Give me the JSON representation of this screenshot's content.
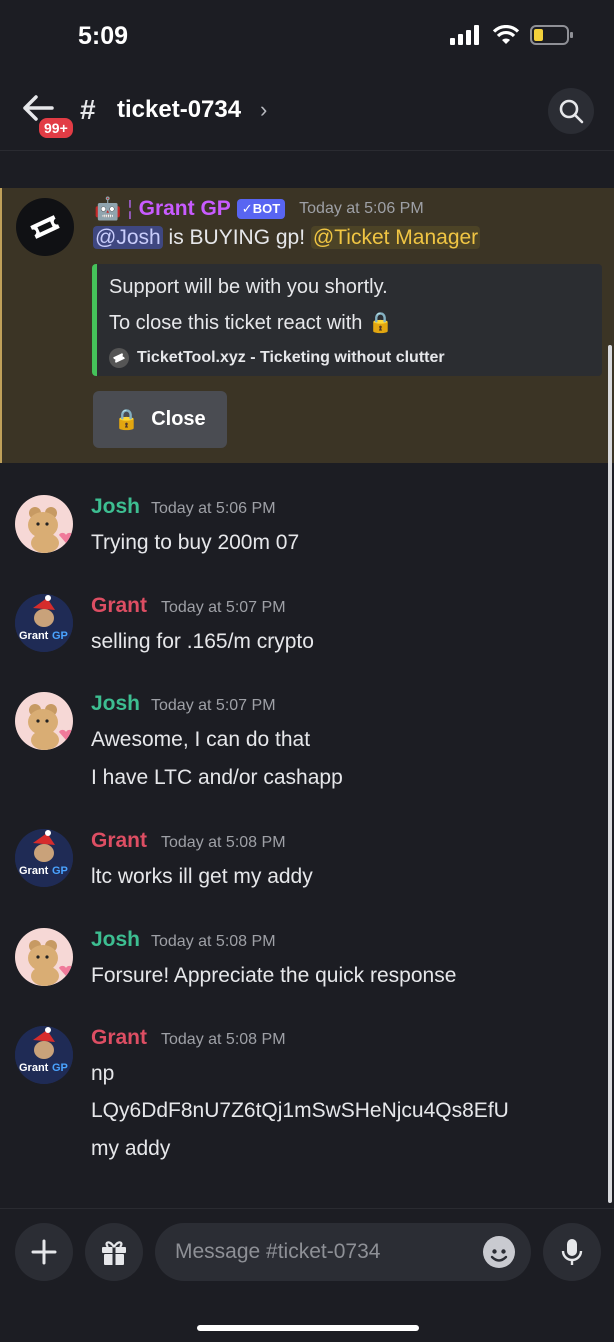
{
  "status": {
    "time": "5:09"
  },
  "header": {
    "badge": "99+",
    "channel": "ticket-0734",
    "hash": "#",
    "chevron": "›"
  },
  "bot_message": {
    "author": "Grant GP",
    "tag": "✓BOT",
    "timestamp": "Today at 5:06 PM",
    "mention_user": "@Josh",
    "middle_text": " is BUYING gp! ",
    "mention_role": "@Ticket Manager",
    "embed": {
      "line1": "Support will be with you shortly.",
      "line2": "To close this ticket react with",
      "footer": "TicketTool.xyz - Ticketing without clutter"
    },
    "button_label": "Close"
  },
  "messages": [
    {
      "author": "Josh",
      "timestamp": "Today at 5:06 PM",
      "lines": [
        "Trying to buy 200m 07"
      ]
    },
    {
      "author": "Grant",
      "timestamp": "Today at 5:07 PM",
      "lines": [
        "selling for .165/m crypto"
      ]
    },
    {
      "author": "Josh",
      "timestamp": "Today at 5:07 PM",
      "lines": [
        "Awesome, I can do that",
        "I have LTC and/or cashapp"
      ]
    },
    {
      "author": "Grant",
      "timestamp": "Today at 5:08 PM",
      "lines": [
        "ltc works ill get my addy"
      ]
    },
    {
      "author": "Josh",
      "timestamp": "Today at 5:08 PM",
      "lines": [
        "Forsure! Appreciate the quick response"
      ]
    },
    {
      "author": "Grant",
      "timestamp": "Today at 5:08 PM",
      "lines": [
        "np",
        "LQy6DdF8nU7Z6tQj1mSwSHeNjcu4Qs8EfU",
        "my addy"
      ]
    }
  ],
  "composer": {
    "placeholder": "Message #ticket-0734"
  },
  "colors": {
    "bot_name": "#c85bff",
    "josh": "#3dbe91",
    "grant": "#dd4e63",
    "embed_bar": "#45c25a"
  }
}
